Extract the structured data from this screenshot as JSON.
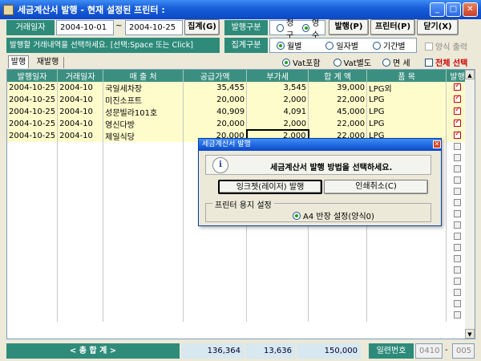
{
  "window": {
    "title": "세금계산서 발행 - 현재 설정된 프린터 :"
  },
  "toolbar": {
    "date_label": "거래일자",
    "date_from": "2004-10-01",
    "tilde": "~",
    "date_to": "2004-10-25",
    "aggregate_button": "집계(G)",
    "issue_type_label": "발행구분",
    "issue_opt1": "청구",
    "issue_opt2": "영수",
    "issue_button": "발행(P)",
    "printer_button": "프린터(P)",
    "close_button": "닫기(X)"
  },
  "row2": {
    "instruction": "발행할 거래내역을 선택하세요. [선택:Space 또는 Click]",
    "agg_type_label": "집계구분",
    "agg_opt1": "월별",
    "agg_opt2": "일자별",
    "agg_opt3": "기간별",
    "print_form": "양식 출력"
  },
  "row3": {
    "tab1": "발행",
    "tab2": "재발행",
    "vat_opt1": "Vat포함",
    "vat_opt2": "Vat별도",
    "vat_opt3": "면 세",
    "select_all": "전체 선택"
  },
  "table": {
    "headers": [
      "발행일자",
      "거래일자",
      "매 출 처",
      "공급가액",
      "부가세",
      "합 계 액",
      "품 목",
      "발행"
    ],
    "rows": [
      {
        "issue_date": "2004-10-25",
        "trade_date": "2004-10",
        "client": "국일세차장",
        "supply": "35,455",
        "vat": "3,545",
        "total": "39,000",
        "item": "LPG외"
      },
      {
        "issue_date": "2004-10-25",
        "trade_date": "2004-10",
        "client": "미진소프트",
        "supply": "20,000",
        "vat": "2,000",
        "total": "22,000",
        "item": "LPG"
      },
      {
        "issue_date": "2004-10-25",
        "trade_date": "2004-10",
        "client": "성문빌라101호",
        "supply": "40,909",
        "vat": "4,091",
        "total": "45,000",
        "item": "LPG"
      },
      {
        "issue_date": "2004-10-25",
        "trade_date": "2004-10",
        "client": "영신다방",
        "supply": "20,000",
        "vat": "2,000",
        "total": "22,000",
        "item": "LPG"
      },
      {
        "issue_date": "2004-10-25",
        "trade_date": "2004-10",
        "client": "제일식당",
        "supply": "20,000",
        "vat": "2,000",
        "total": "22,000",
        "item": "LPG"
      }
    ]
  },
  "dialog": {
    "title": "세금계산서 발행",
    "message": "세금계산서 발행 방법을 선택하세요.",
    "btn_inkjet": "잉크젯(레이저) 발행",
    "btn_cancel": "인쇄취소(C)",
    "group_label": "프린터 용지 설정",
    "paper_option": "A4 반장 설정(양식0)"
  },
  "footer": {
    "total_label": "< 총   합   계 >",
    "supply_total": "136,364",
    "vat_total": "13,636",
    "grand_total": "150,000",
    "serial_label": "일련번호",
    "serial_from": "0410",
    "serial_dash": "-",
    "serial_to": "005"
  }
}
